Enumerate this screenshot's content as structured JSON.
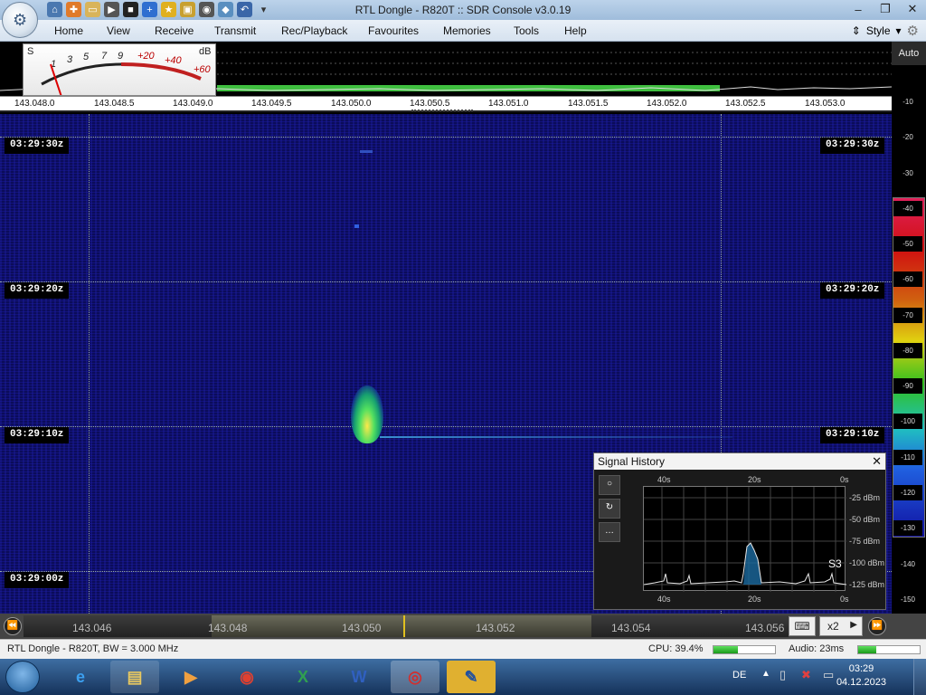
{
  "window": {
    "title": "RTL Dongle - R820T :: SDR Console v3.0.19",
    "minimize": "–",
    "maximize": "❐",
    "close": "✕"
  },
  "menu": {
    "items": [
      "Home",
      "View",
      "Receive",
      "Transmit",
      "Rec/Playback",
      "Favourites",
      "Memories",
      "Tools",
      "Help"
    ],
    "style_label": "Style"
  },
  "smeter": {
    "s_label": "S",
    "db_label": "dB",
    "s_marks": [
      "1",
      "3",
      "5",
      "7",
      "9"
    ],
    "db_marks": [
      "+20",
      "+40",
      "+60"
    ]
  },
  "spectrum": {
    "freq_labels": [
      "143.048.0",
      "143.048.5",
      "143.049.0",
      "143.049.5",
      "143.050.0",
      "143.050.5",
      "143.051.0",
      "143.051.5",
      "143.052.0",
      "143.052.5",
      "143.053.0"
    ]
  },
  "waterfall": {
    "timestamps": [
      "03:29:30z",
      "03:29:20z",
      "03:29:10z",
      "03:29:00z"
    ]
  },
  "db_scale": {
    "auto_label": "Auto",
    "levels": [
      "-10",
      "-20",
      "-30",
      "-40",
      "-50",
      "-60",
      "-70",
      "-80",
      "-90",
      "-100",
      "-110",
      "-120",
      "-130",
      "-140",
      "-150"
    ]
  },
  "signal_history": {
    "title": "Signal History",
    "close": "✕",
    "buttons": [
      "○",
      "↻",
      "…"
    ],
    "top_axis": [
      "40s",
      "20s",
      "0s"
    ],
    "bottom_axis": [
      "40s",
      "20s",
      "0s"
    ],
    "y_axis": [
      "-25 dBm",
      "-50 dBm",
      "-75 dBm",
      "-100 dBm",
      "-125 dBm"
    ],
    "s_reading": "S3"
  },
  "bottom_scale": {
    "labels": [
      "143.046",
      "143.048",
      "143.050",
      "143.052",
      "143.054",
      "143.056"
    ],
    "zoom": "x2"
  },
  "status": {
    "left": "RTL Dongle - R820T, BW = 3.000 MHz",
    "cpu": "CPU: 39.4%",
    "cpu_level": 0.394,
    "audio": "Audio: 23ms",
    "audio_level": 0.3
  },
  "taskbar": {
    "lang": "DE",
    "time": "03:29",
    "date": "04.12.2023"
  },
  "colors": {
    "waterfall_bg": "#0b0c5a",
    "spectrum_green": "#3fbf3f",
    "accent_red": "#c02020"
  }
}
